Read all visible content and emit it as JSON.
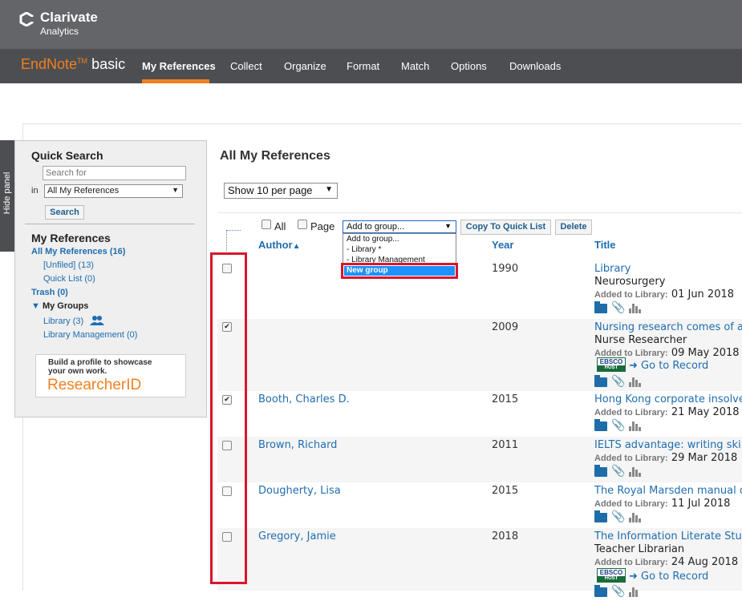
{
  "brand": {
    "name": "Clarivate",
    "sub": "Analytics"
  },
  "app": {
    "name_main": "EndNote",
    "name_tm": "TM",
    "name_suffix": "basic"
  },
  "nav": {
    "items": [
      "My References",
      "Collect",
      "Organize",
      "Format",
      "Match",
      "Options",
      "Downloads"
    ],
    "active": "My References"
  },
  "hide_panel": "Hide panel",
  "quick_search": {
    "title": "Quick Search",
    "placeholder": "Search for",
    "in_label": "in",
    "scope": "All My References",
    "button": "Search"
  },
  "my_references": {
    "title": "My References",
    "all": "All My References (16)",
    "unfiled": "[Unfiled] (13)",
    "quick_list": "Quick List (0)",
    "trash": "Trash (0)",
    "groups_label": "My Groups",
    "groups": [
      {
        "name": "Library",
        "count": "(3)"
      },
      {
        "name": "Library Management",
        "count": "(0)"
      }
    ]
  },
  "researcherid": {
    "promo_line1": "Build a profile to showcase",
    "promo_line2": "your own work.",
    "name": "ResearcherID"
  },
  "main": {
    "title": "All My References",
    "per_page": "Show 10 per page",
    "toolbar": {
      "all_label": "All",
      "page_label": "Page",
      "add_to_group": "Add to group...",
      "copy_quick_list": "Copy To Quick List",
      "delete": "Delete"
    },
    "dropdown_options": [
      "Add to group...",
      "- Library *",
      "- Library Management",
      "New group"
    ],
    "columns": {
      "author": "Author",
      "year": "Year",
      "title": "Title"
    },
    "added_label": "Added to Library:",
    "go_to_record": "Go to Record",
    "ebsco": {
      "top": "EBSCO",
      "bottom": "HOST"
    },
    "rows": [
      {
        "checked": false,
        "author": "",
        "year": "1990",
        "title": "Library",
        "journal": "Neurosurgery",
        "added": "01 Jun 2018",
        "ebsco": false
      },
      {
        "checked": true,
        "author": "",
        "year": "2009",
        "title": "Nursing research comes of a",
        "journal": "Nurse Researcher",
        "added": "09 May 2018",
        "ebsco": true
      },
      {
        "checked": true,
        "author": "Booth, Charles D.",
        "year": "2015",
        "title": "Hong Kong corporate insolve",
        "journal": "",
        "added": "21 May 2018",
        "ebsco": false
      },
      {
        "checked": false,
        "author": "Brown, Richard",
        "year": "2011",
        "title": "IELTS advantage: writing ski",
        "journal": "",
        "added": "29 Mar 2018",
        "ebsco": false
      },
      {
        "checked": false,
        "author": "Dougherty, Lisa",
        "year": "2015",
        "title": "The Royal Marsden manual o",
        "journal": "",
        "added": "11 Jul 2018",
        "ebsco": false
      },
      {
        "checked": false,
        "author": "Gregory, Jamie",
        "year": "2018",
        "title": "The Information Literate Stu",
        "journal": "Teacher Librarian",
        "added": "24 Aug 2018",
        "ebsco": true
      }
    ]
  },
  "colors": {
    "accent": "#f08020",
    "link": "#1f6db0",
    "highlight": "#d8162d",
    "header": "#646569"
  }
}
